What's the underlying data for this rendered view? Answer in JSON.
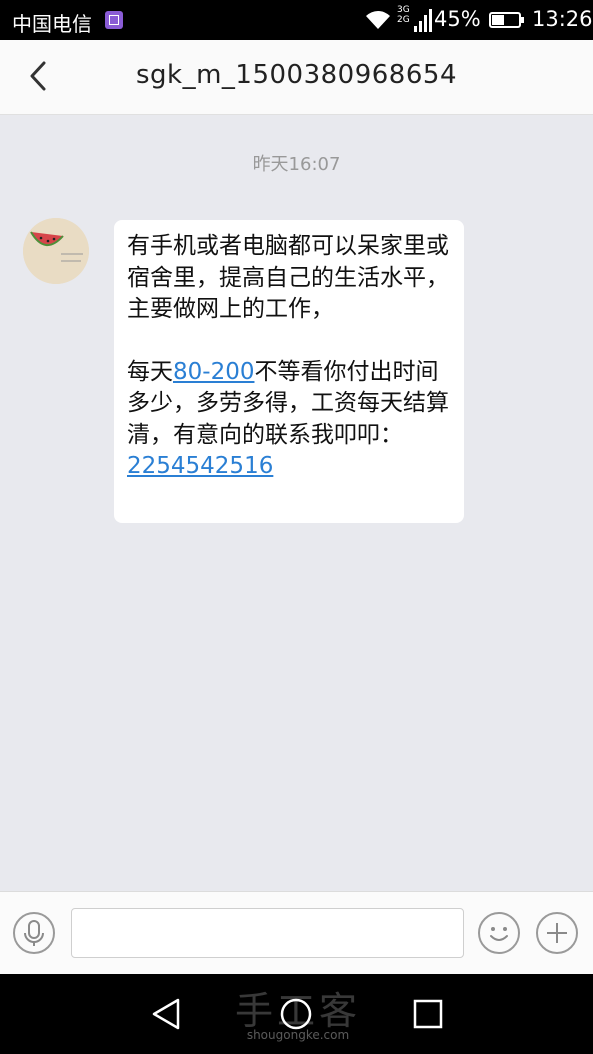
{
  "status_bar": {
    "carrier": "中国电信",
    "network_top": "3G",
    "network_bottom": "2G",
    "battery_percent": "45%",
    "time": "13:26"
  },
  "header": {
    "title": "sgk_m_1500380968654"
  },
  "conversation": {
    "timestamp": "昨天16:07",
    "message": {
      "line1": "有手机或者电脑都可以呆家里或宿舍里，提高自己的生活水平，主要做网上的工作，",
      "line2_prefix": "每天",
      "line2_link": "80-200",
      "line2_suffix": "不等看你付出时间多少，多劳多得，工资每天结算清，有意向的联系我叩叩：",
      "contact_link": "2254542516"
    }
  },
  "input_bar": {
    "placeholder": ""
  },
  "watermark": {
    "text": "手工客",
    "url": "shougongke.com"
  },
  "colors": {
    "background": "#e8e9ee",
    "link": "#2a7fd4",
    "bubble": "#ffffff"
  }
}
